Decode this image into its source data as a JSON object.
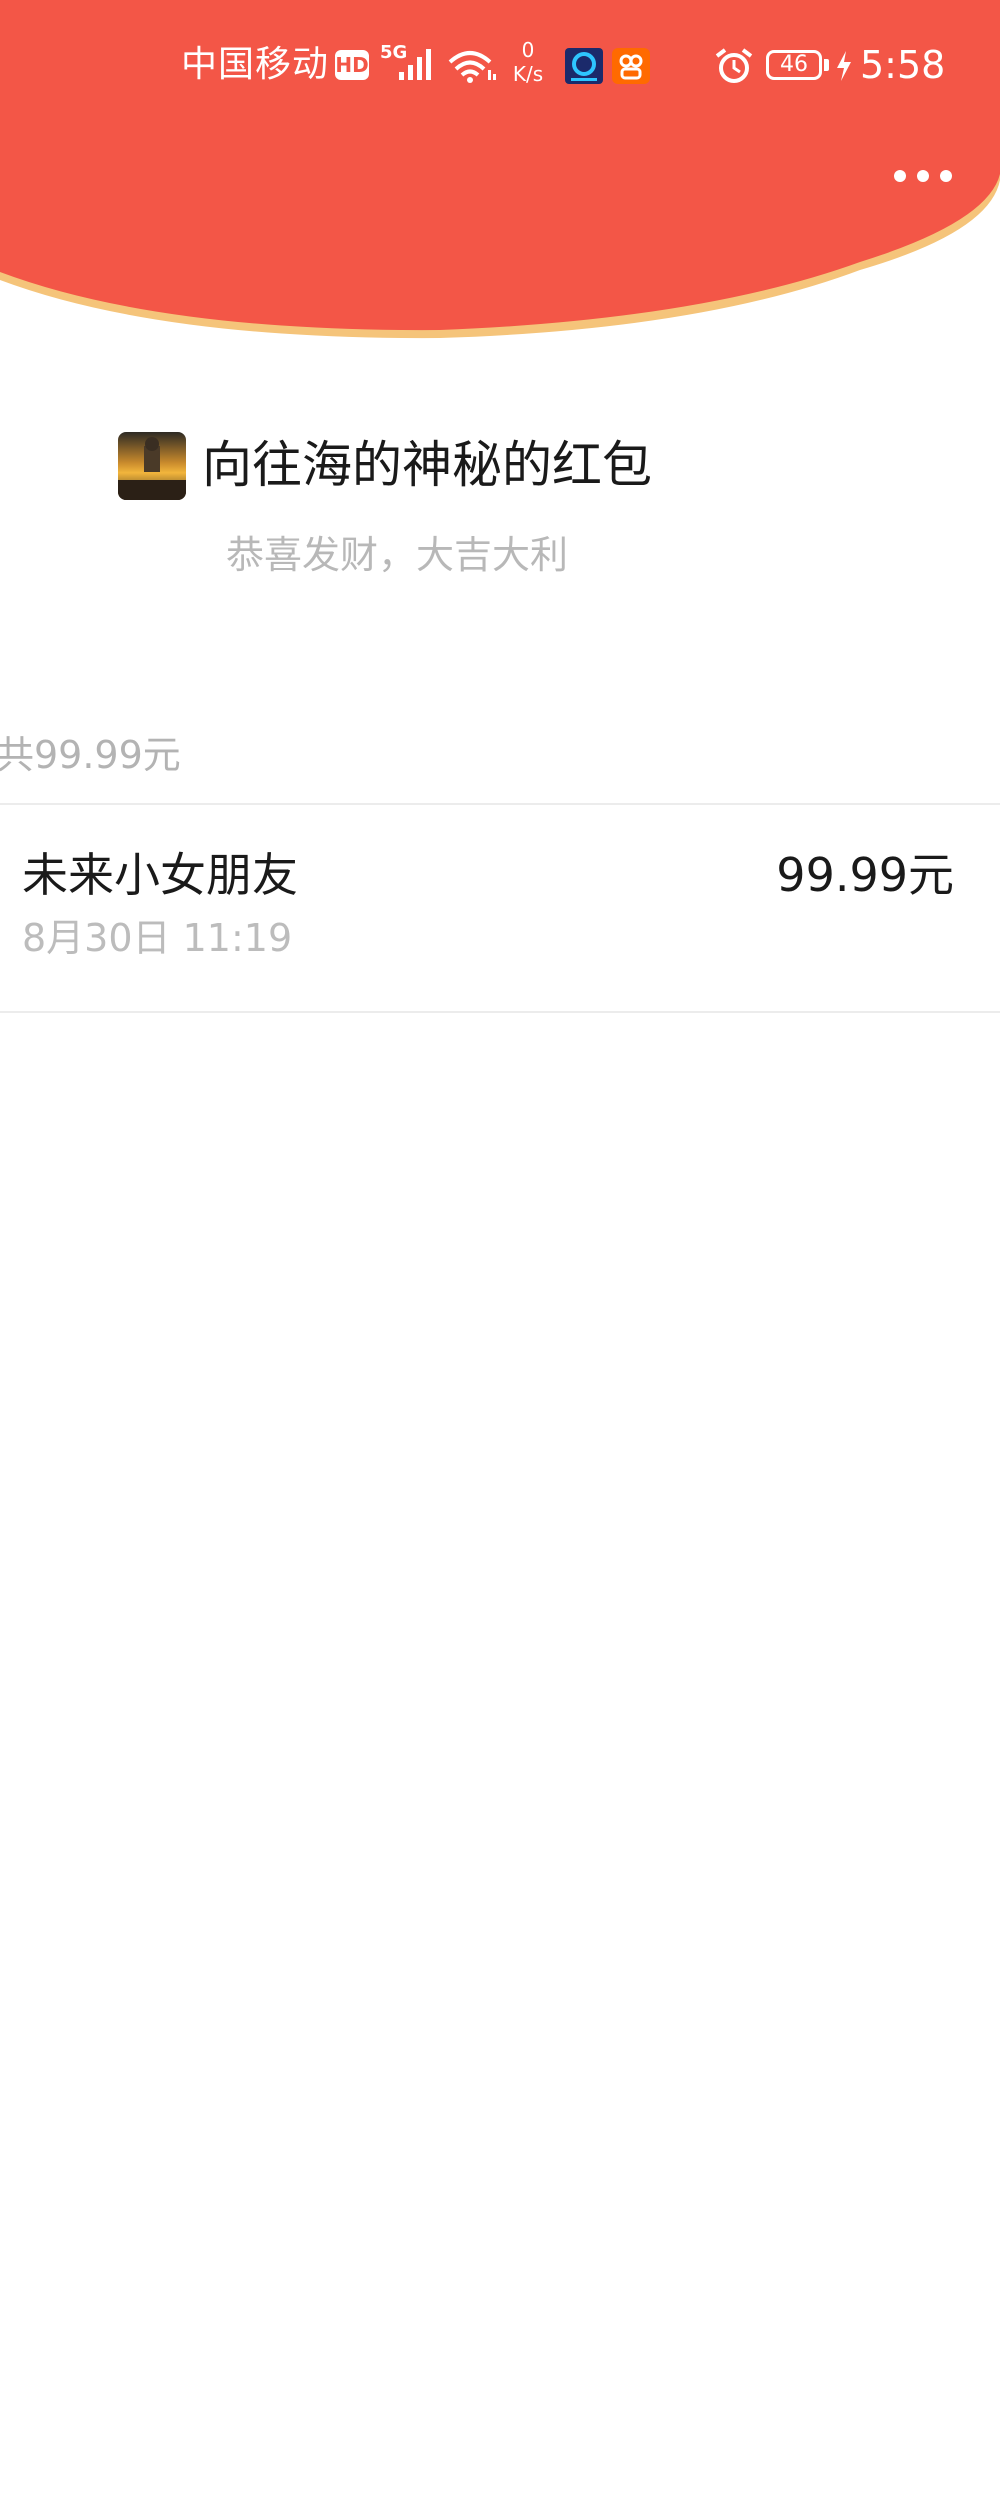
{
  "status_bar": {
    "carrier": "中国移动",
    "hd": "HD",
    "network_generation": "5G",
    "net_speed_value": "0",
    "net_speed_unit": "K/s",
    "battery_level": "46",
    "time": "5:58"
  },
  "header": {
    "more_icon": "more-dots-icon"
  },
  "red_packet": {
    "title": "向往海的神秘的红包",
    "blessing": "恭喜发财，大吉大利",
    "total_summary": "共99.99元"
  },
  "records": [
    {
      "recipient": "未来小女朋友",
      "time": "8月30日  11:19",
      "amount": "99.99元"
    }
  ],
  "colors": {
    "header_red": "#f35647",
    "header_edge_gold": "#f5c47a"
  }
}
